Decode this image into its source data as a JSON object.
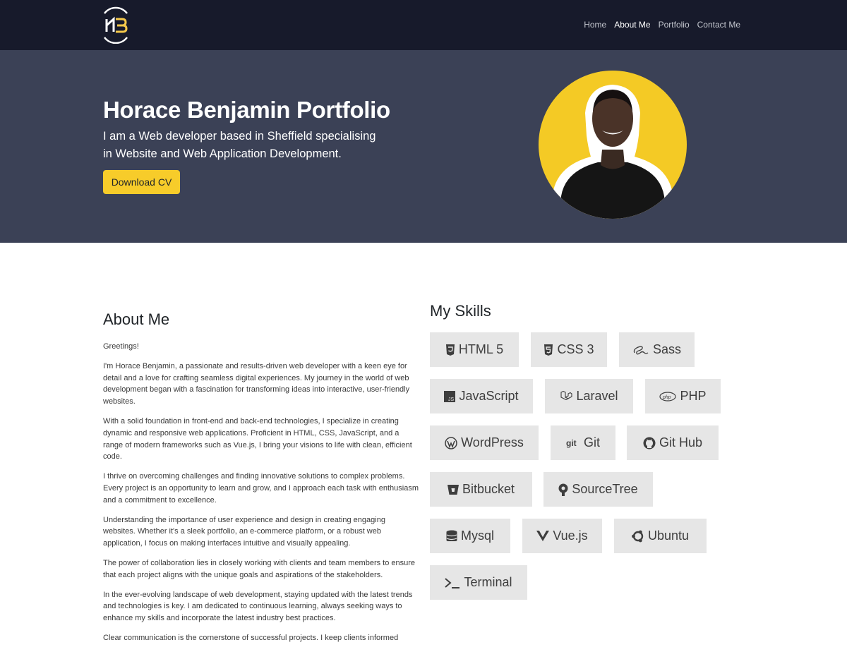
{
  "nav": {
    "logo_text": "HB",
    "links": [
      {
        "label": "Home"
      },
      {
        "label": "About Me"
      },
      {
        "label": "Portfolio"
      },
      {
        "label": "Contact Me"
      }
    ]
  },
  "hero": {
    "title": "Horace Benjamin Portfolio",
    "subtitle": "I am a Web developer based in Sheffield specialising in Website and Web Application Development.",
    "cta_label": "Download CV"
  },
  "about": {
    "heading": "About Me",
    "paragraphs": [
      "Greetings!",
      "I'm Horace Benjamin, a passionate and results-driven web developer with a keen eye for detail and a love for crafting seamless digital experiences. My journey in the world of web development began with a fascination for transforming ideas into interactive, user-friendly websites.",
      "With a solid foundation in front-end and back-end technologies, I specialize in creating dynamic and responsive web applications. Proficient in HTML, CSS, JavaScript, and a range of modern frameworks such as Vue.js, I bring your visions to life with clean, efficient code.",
      "I thrive on overcoming challenges and finding innovative solutions to complex problems. Every project is an opportunity to learn and grow, and I approach each task with enthusiasm and a commitment to excellence.",
      "Understanding the importance of user experience and design in creating engaging websites. Whether it's a sleek portfolio, an e-commerce platform, or a robust web application, I focus on making interfaces intuitive and visually appealing.",
      "The power of collaboration lies in closely working with clients and team members to ensure that each project aligns with the unique goals and aspirations of the stakeholders.",
      "In the ever-evolving landscape of web development, staying updated with the latest trends and technologies is key. I am dedicated to continuous learning, always seeking ways to enhance my skills and incorporate the latest industry best practices.",
      "Clear communication is the cornerstone of successful projects. I keep clients informed"
    ]
  },
  "skills": {
    "heading": "My Skills",
    "items": [
      {
        "label": "HTML 5",
        "icon": "html5-icon"
      },
      {
        "label": "CSS 3",
        "icon": "css3-icon"
      },
      {
        "label": "Sass",
        "icon": "sass-icon"
      },
      {
        "label": "JavaScript",
        "icon": "javascript-icon"
      },
      {
        "label": "Laravel",
        "icon": "laravel-icon"
      },
      {
        "label": "PHP",
        "icon": "php-icon"
      },
      {
        "label": "WordPress",
        "icon": "wordpress-icon"
      },
      {
        "label": "Git",
        "icon": "git-icon"
      },
      {
        "label": "Git Hub",
        "icon": "github-icon"
      },
      {
        "label": "Bitbucket",
        "icon": "bitbucket-icon"
      },
      {
        "label": "SourceTree",
        "icon": "sourcetree-icon"
      },
      {
        "label": "Mysql",
        "icon": "database-icon"
      },
      {
        "label": "Vue.js",
        "icon": "vuejs-icon"
      },
      {
        "label": "Ubuntu",
        "icon": "ubuntu-icon"
      },
      {
        "label": "Terminal",
        "icon": "terminal-icon"
      }
    ]
  },
  "colors": {
    "navbar": "#171a2b",
    "hero": "#3b4156",
    "accent": "#f7cc2a",
    "skill_bg": "#e6e6e6"
  }
}
